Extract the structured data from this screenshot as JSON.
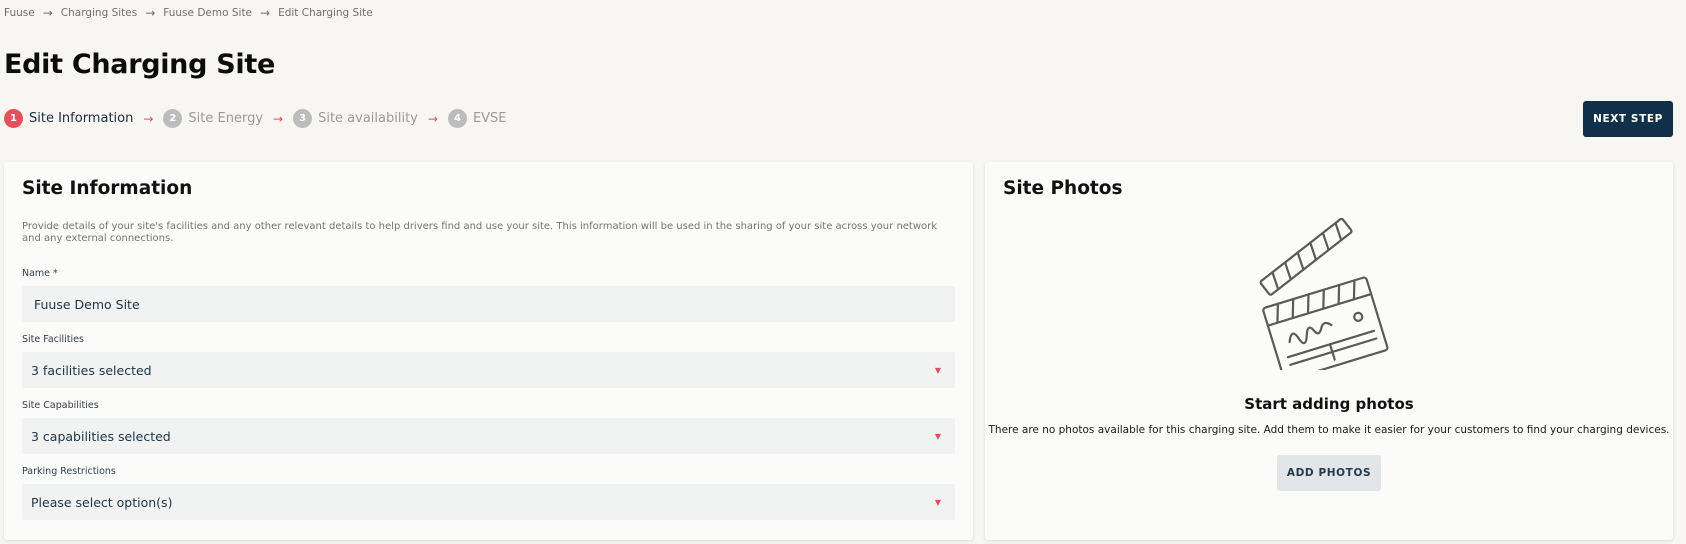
{
  "breadcrumb": {
    "items": [
      "Fuuse",
      "Charging Sites",
      "Fuuse Demo Site",
      "Edit Charging Site"
    ]
  },
  "page": {
    "title": "Edit Charging Site"
  },
  "stepper": {
    "steps": [
      {
        "number": "1",
        "label": "Site Information",
        "state": "active"
      },
      {
        "number": "2",
        "label": "Site Energy",
        "state": "inactive"
      },
      {
        "number": "3",
        "label": "Site availability",
        "state": "inactive"
      },
      {
        "number": "4",
        "label": "EVSE",
        "state": "inactive"
      }
    ],
    "next_label": "NEXT STEP"
  },
  "site_info": {
    "title": "Site Information",
    "description": "Provide details of your site's facilities and any other relevant details to help drivers find and use your site. This information will be used in the sharing of your site across your network and any external connections.",
    "name": {
      "label": "Name *",
      "value": "Fuuse Demo Site"
    },
    "facilities": {
      "label": "Site Facilities",
      "value": "3 facilities selected"
    },
    "capabilities": {
      "label": "Site Capabilities",
      "value": "3 capabilities selected"
    },
    "parking": {
      "label": "Parking Restrictions",
      "value": "Please select option(s)"
    }
  },
  "site_photos": {
    "title": "Site Photos",
    "empty_title": "Start adding photos",
    "empty_description": "There are no photos available for this charging site. Add them to make it easier for your customers to find your charging devices.",
    "add_label": "ADD PHOTOS"
  },
  "icons": {
    "breadcrumb_separator": "arrow-right-icon",
    "step_separator": "arrow-right-icon",
    "dropdown": "caret-down-icon",
    "empty_state": "clapperboard-icon"
  },
  "colors": {
    "accent": "#e4505d",
    "primary_button": "#10304a",
    "secondary_button": "#e3e6e8",
    "background": "#f7f6f3",
    "card": "#fbfbfa",
    "field": "#f1f3f3"
  }
}
